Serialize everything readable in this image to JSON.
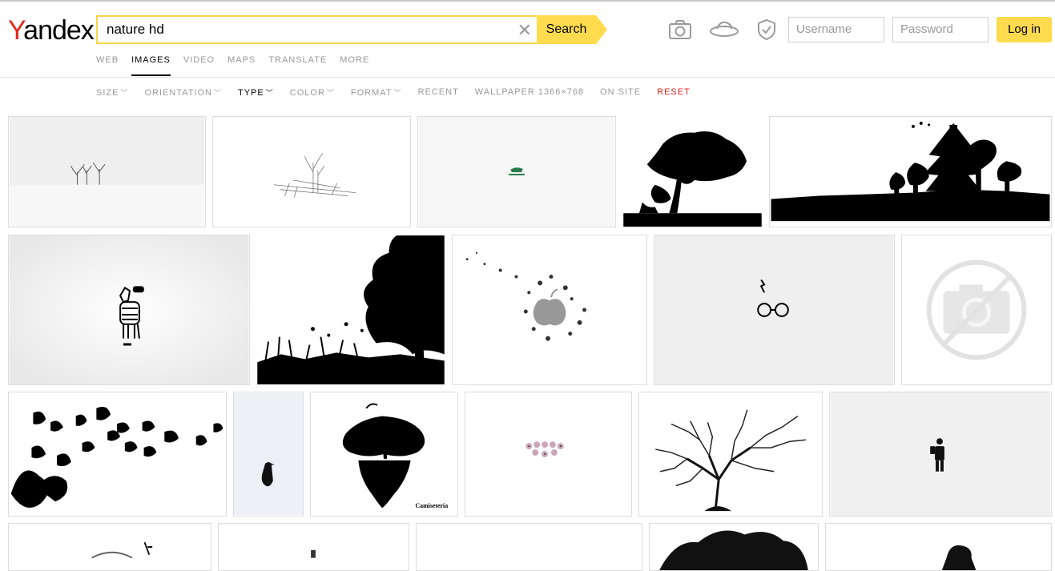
{
  "logo": {
    "first": "Y",
    "rest": "andex"
  },
  "search": {
    "query": "nature hd",
    "button_label": "Search",
    "clear_glyph": "✕"
  },
  "auth": {
    "username_placeholder": "Username",
    "password_placeholder": "Password",
    "login_label": "Log in"
  },
  "header_icons": [
    "camera-icon",
    "ufo-icon",
    "shield-icon"
  ],
  "nav": {
    "items": [
      "WEB",
      "IMAGES",
      "VIDEO",
      "MAPS",
      "TRANSLATE",
      "MORE"
    ],
    "active": "IMAGES"
  },
  "filters": {
    "size": "SIZE",
    "orientation": "ORIENTATION",
    "type": "TYPE",
    "color": "COLOR",
    "format": "FORMAT",
    "recent": "RECENT",
    "wallpaper": "WALLPAPER 1366×768",
    "on_site": "ON SITE",
    "reset": "RESET",
    "caret": "﹀"
  },
  "results": [
    "snowy-trees",
    "winter-sketch-tree",
    "lacoste-logo",
    "tree-silhouette",
    "forest-silhouette",
    "zebra",
    "tree-grass-silhouette",
    "apple-logo-butterflies",
    "glasses-lightning",
    "image-unavailable",
    "butterflies",
    "penguin",
    "floating-tree",
    "pink-spheres",
    "bare-tree",
    "hiker-fog",
    "partial-1",
    "partial-2",
    "partial-3",
    "partial-4",
    "partial-5"
  ],
  "colors": {
    "accent": "#ffdb4d",
    "brand_red": "#e52620"
  }
}
